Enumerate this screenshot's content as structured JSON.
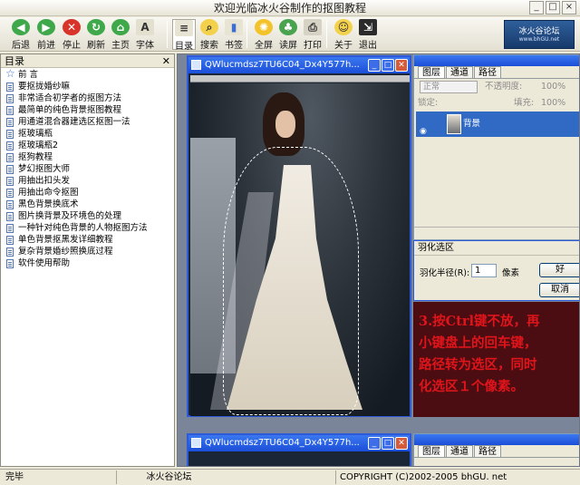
{
  "window": {
    "title": "欢迎光临冰火谷制作的抠图教程"
  },
  "toolbar": {
    "buttons": [
      {
        "label": "后退",
        "icon": "back-arrow-icon"
      },
      {
        "label": "前进",
        "icon": "forward-arrow-icon"
      },
      {
        "label": "停止",
        "icon": "stop-icon"
      },
      {
        "label": "刷新",
        "icon": "refresh-icon"
      },
      {
        "label": "主页",
        "icon": "home-icon"
      },
      {
        "label": "字体",
        "icon": "font-icon"
      },
      {
        "label": "目录",
        "icon": "contents-icon"
      },
      {
        "label": "搜索",
        "icon": "search-icon"
      },
      {
        "label": "书签",
        "icon": "bookmark-icon"
      },
      {
        "label": "全屏",
        "icon": "fullscreen-icon"
      },
      {
        "label": "读屏",
        "icon": "read-screen-icon"
      },
      {
        "label": "打印",
        "icon": "print-icon"
      },
      {
        "label": "关于",
        "icon": "about-icon"
      },
      {
        "label": "退出",
        "icon": "exit-icon"
      }
    ],
    "logo_text": "冰火谷论坛",
    "logo_sub": "www.bhGU.net"
  },
  "left_panel": {
    "title": "目录",
    "items": [
      "前 言",
      "要抠拢婚纱嘛",
      "非常适合初学者的抠图方法",
      "最简单的纯色背景抠图教程",
      "用通道混合器建选区抠图一法",
      "抠玻璃瓶",
      "抠玻璃瓶2",
      "抠狗教程",
      "梦幻抠图大师",
      "用抽出扣头发",
      "用抽出命令抠图",
      "黑色背景换底术",
      "图片换背景及环境色的处理",
      "一种针对纯色背景的人物抠图方法",
      "单色背景抠黑发详细教程",
      "复杂背景婚纱照换底过程",
      "软件使用帮助"
    ]
  },
  "ps_window": {
    "title": "QWlucmdsz7TU6C04_Dx4Y577h..."
  },
  "layers_panel": {
    "tabs": [
      "图层",
      "通道",
      "路径"
    ],
    "blend_mode": "正常",
    "opacity_label": "不透明度:",
    "lock_label": "锁定:",
    "fill_label": "填充:",
    "opacity_value": "100%",
    "fill_value": "100%",
    "layer_name": "背景"
  },
  "feather_dialog": {
    "title": "羽化选区",
    "radius_label": "羽化半径(R):",
    "radius_value": "1",
    "unit": "像素",
    "ok_label": "好",
    "cancel_label": "取消"
  },
  "instructions": {
    "lines": [
      "3.按Ctrl键不放，再",
      "小键盘上的回车键，",
      "路径转为选区，同时",
      "化选区１个像素。"
    ]
  },
  "ps_window2": {
    "title": "QWlucmdsz7TU6C04_Dx4Y577h..."
  },
  "status": {
    "left": "完毕",
    "mid": "冰火谷论坛",
    "right": "COPYRIGHT (C)2002-2005 bhGU. net"
  }
}
